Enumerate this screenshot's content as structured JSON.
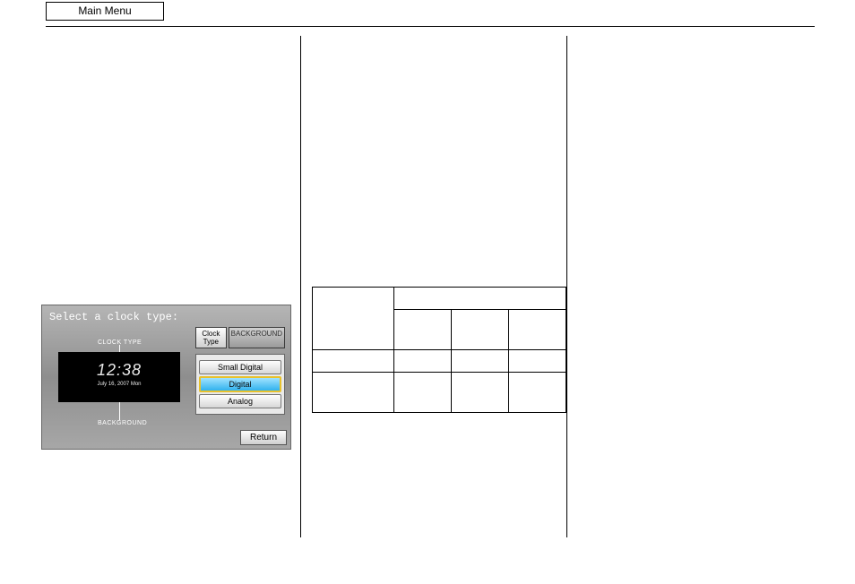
{
  "header": {
    "main_menu": "Main Menu"
  },
  "device": {
    "prompt": "Select a clock type:",
    "label_clock_type": "CLOCK TYPE",
    "label_background": "BACKGROUND",
    "preview_time": "12:38",
    "preview_date": "July 16, 2007  Mon",
    "tab_clock_type": "Clock Type",
    "tab_background": "BACKGROUND",
    "opt_small_digital": "Small Digital",
    "opt_digital": "Digital",
    "opt_analog": "Analog",
    "return": "Return"
  },
  "table": {
    "header_main": "",
    "header_span": "",
    "r1c1": "",
    "r1c2": "",
    "r1c3": "",
    "r1c4": "",
    "r2c1": "",
    "r2c2": "",
    "r2c3": "",
    "r2c4": "",
    "r3c1": "",
    "r3c2": "",
    "r3c3": "",
    "r3c4": ""
  }
}
